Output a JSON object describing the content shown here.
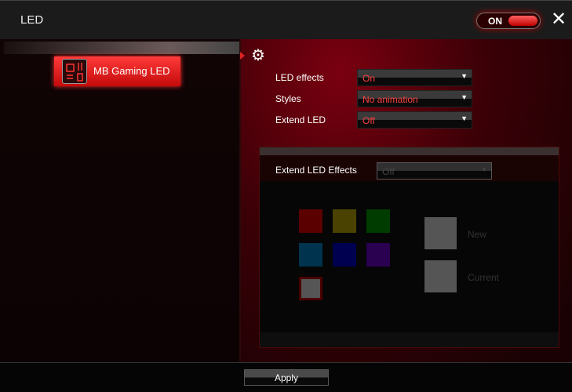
{
  "window": {
    "title": "LED",
    "power_toggle": {
      "label": "ON",
      "state": true
    },
    "close_icon": "close-icon"
  },
  "sidebar": {
    "items": [
      {
        "label": "MB Gaming LED",
        "icon": "motherboard-icon",
        "selected": true
      }
    ]
  },
  "settings": {
    "gear_icon": "gear-icon",
    "rows": [
      {
        "label": "LED effects",
        "value": "On"
      },
      {
        "label": "Styles",
        "value": "No animation"
      },
      {
        "label": "Extend LED",
        "value": "Off"
      }
    ]
  },
  "extend": {
    "label": "Extend LED Effects",
    "value": "Off",
    "swatches": [
      "#5a0000",
      "#4a4200",
      "#003c00",
      "#00334d",
      "#000050",
      "#2a0050",
      "#555555"
    ],
    "new_label": "New",
    "current_label": "Current"
  },
  "footer": {
    "apply_label": "Apply"
  }
}
